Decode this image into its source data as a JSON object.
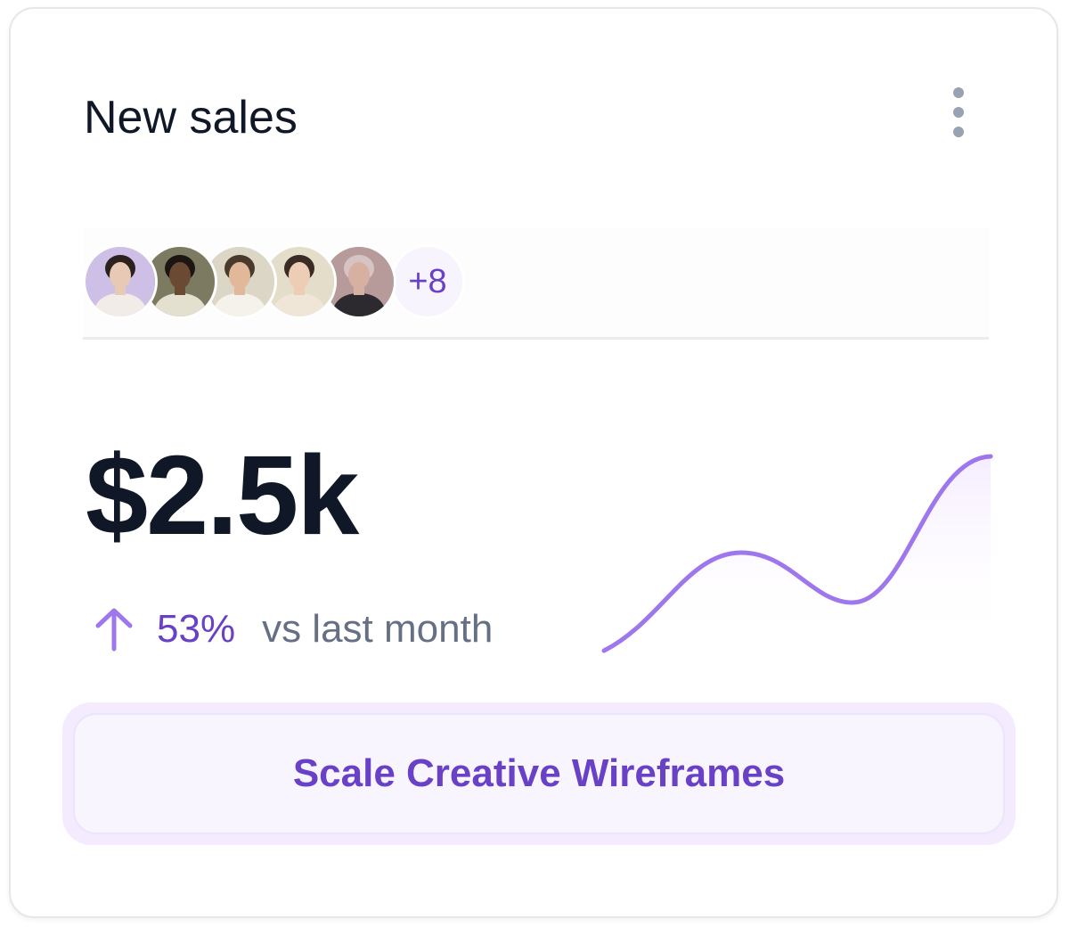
{
  "card": {
    "title": "New sales",
    "menu_icon": "more-vertical-icon"
  },
  "avatars": {
    "items": [
      {
        "name": "avatar-1",
        "bg": "#cdbfe6",
        "skin": "#e8c9b5",
        "hair": "#2b2220",
        "shirt": "#f1ece8"
      },
      {
        "name": "avatar-2",
        "bg": "#7d7a62",
        "skin": "#6b4a34",
        "hair": "#1c1512",
        "shirt": "#e3e0cf"
      },
      {
        "name": "avatar-3",
        "bg": "#dcd6c6",
        "skin": "#e2b89a",
        "hair": "#4a3a2c",
        "shirt": "#f5f2ec"
      },
      {
        "name": "avatar-4",
        "bg": "#e4ddc9",
        "skin": "#edcdb5",
        "hair": "#3a2c24",
        "shirt": "#efe6d8"
      },
      {
        "name": "avatar-5",
        "bg": "#b79a9a",
        "skin": "#d6b0a0",
        "hair": "#d6c4c4",
        "shirt": "#2c2a2e"
      }
    ],
    "more_label": "+8"
  },
  "metric": {
    "value": "$2.5k",
    "change_pct": "53%",
    "change_label": "vs last month",
    "direction": "up",
    "trend_icon": "arrow-up-icon"
  },
  "cta": {
    "label": "Scale Creative Wireframes"
  },
  "colors": {
    "accent": "#6941c6",
    "accent_line": "#9e77ed",
    "text_primary": "#101828",
    "text_secondary": "#667085"
  }
}
